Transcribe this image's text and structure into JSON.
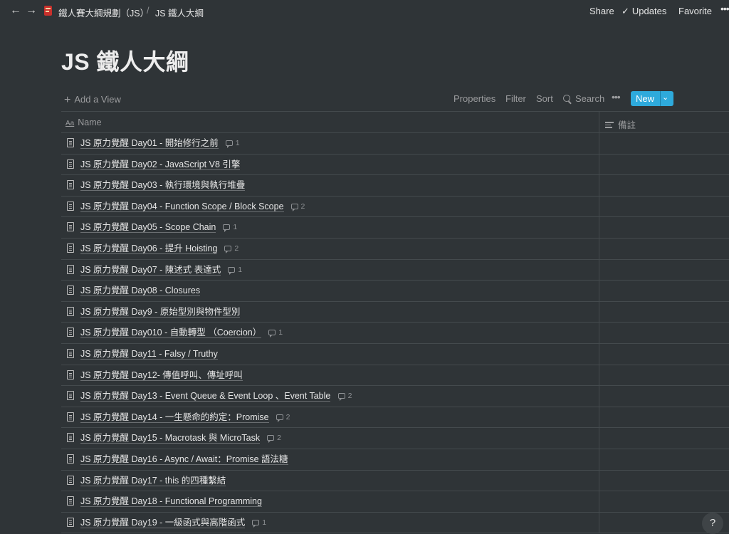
{
  "topbar": {
    "back_glyph": "←",
    "forward_glyph": "→",
    "breadcrumb_parent": "鐵人賽大綱規劃（JS）",
    "breadcrumb_separator": "/",
    "breadcrumb_current": "JS 鐵人大綱",
    "share": "Share",
    "updates": "Updates",
    "favorite": "Favorite",
    "more": "•••"
  },
  "page": {
    "title": "JS 鐵人大綱"
  },
  "viewbar": {
    "add_view": "Add a View",
    "properties": "Properties",
    "filter": "Filter",
    "sort": "Sort",
    "search": "Search",
    "more": "•••",
    "new": "New"
  },
  "table": {
    "columns": {
      "name_icon": "Aa",
      "name": "Name",
      "notes": "備註"
    },
    "rows": [
      {
        "title": "JS 原力覺醒 Day01 - 開始修行之前",
        "comments": "1"
      },
      {
        "title": "JS 原力覺醒 Day02 - JavaScript V8 引擎",
        "comments": ""
      },
      {
        "title": "JS 原力覺醒 Day03 - 執行環境與執行堆疊",
        "comments": ""
      },
      {
        "title": "JS 原力覺醒 Day04 - Function Scope / Block Scope",
        "comments": "2"
      },
      {
        "title": "JS 原力覺醒 Day05 - Scope Chain",
        "comments": "1"
      },
      {
        "title": "JS 原力覺醒 Day06 - 提升 Hoisting",
        "comments": "2"
      },
      {
        "title": "JS 原力覺醒 Day07 - 陳述式 表達式",
        "comments": "1"
      },
      {
        "title": "JS 原力覺醒 Day08 - Closures",
        "comments": ""
      },
      {
        "title": "JS 原力覺醒 Day9 - 原始型別與物件型別",
        "comments": ""
      },
      {
        "title": "JS 原力覺醒 Day010 - 自動轉型 （Coercion）",
        "comments": "1"
      },
      {
        "title": "JS 原力覺醒 Day11 - Falsy / Truthy",
        "comments": ""
      },
      {
        "title": "JS 原力覺醒 Day12- 傳值呼叫、傳址呼叫",
        "comments": ""
      },
      {
        "title": "JS 原力覺醒 Day13 - Event Queue & Event Loop 、Event Table",
        "comments": "2"
      },
      {
        "title": "JS 原力覺醒 Day14 - 一生懸命的約定：Promise",
        "comments": "2"
      },
      {
        "title": "JS 原力覺醒 Day15 - Macrotask 與 MicroTask",
        "comments": "2"
      },
      {
        "title": "JS 原力覺醒 Day16 - Async / Await：Promise 語法糖",
        "comments": ""
      },
      {
        "title": "JS 原力覺醒 Day17 - this 的四種繫結",
        "comments": ""
      },
      {
        "title": "JS 原力覺醒 Day18 - Functional Programming",
        "comments": ""
      },
      {
        "title": "JS 原力覺醒 Day19 - 一級函式與高階函式",
        "comments": "1"
      }
    ]
  },
  "help": {
    "label": "?"
  },
  "colors": {
    "background": "#2f3437",
    "accent": "#2eaadc",
    "text": "#ebebeb",
    "muted": "#9b9c9e",
    "border": "#444a4d"
  }
}
